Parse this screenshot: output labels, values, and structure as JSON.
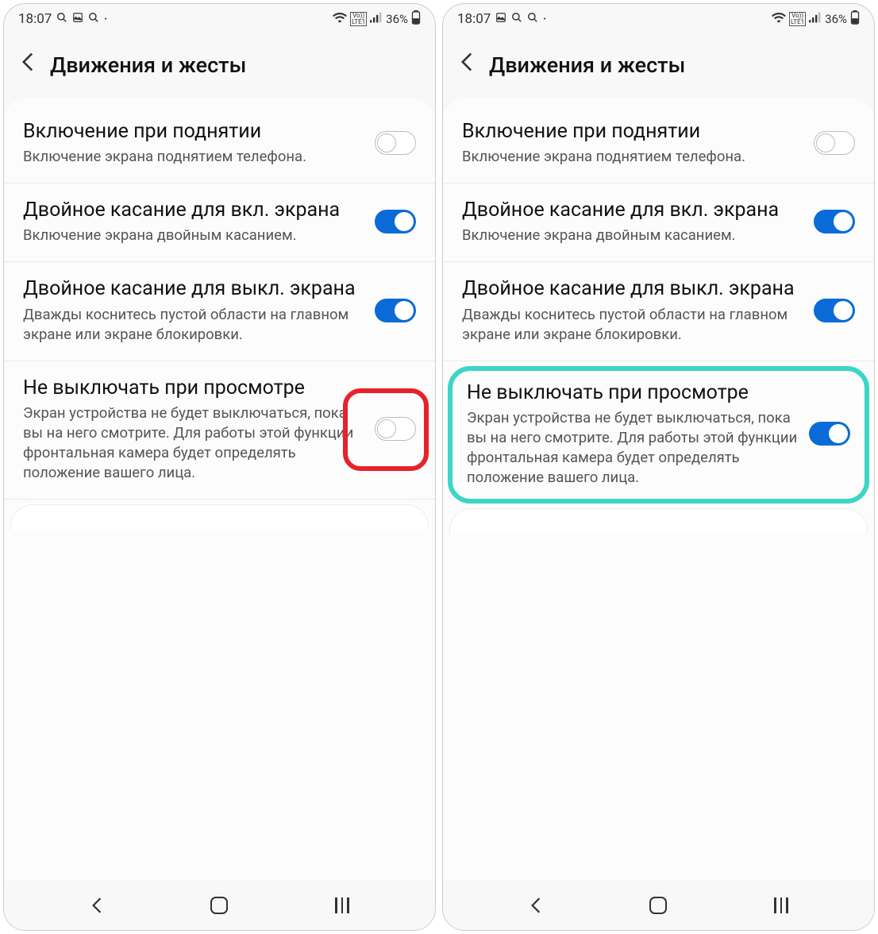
{
  "status": {
    "time": "18:07",
    "icons_left": [
      "search-icon",
      "gallery-icon",
      "search-icon",
      "dot-icon"
    ],
    "volte": "Vo))\nLTE1",
    "battery_pct": "36%"
  },
  "header": {
    "title": "Движения и жесты"
  },
  "items": {
    "lift_wake": {
      "title": "Включение при поднятии",
      "desc": "Включение экрана поднятием телефона."
    },
    "dtap_on": {
      "title": "Двойное касание для вкл. экрана",
      "desc": "Включение экрана двойным касанием."
    },
    "dtap_off": {
      "title": "Двойное касание для выкл. экрана",
      "desc": "Дважды коснитесь пустой области на главном экране или экране блокировки."
    },
    "stay_on": {
      "title": "Не выключать при просмотре",
      "desc": "Экран устройства не будет выключаться, пока вы на него смотрите. Для работы этой функции фронтальная камера будет определять положение вашего лица."
    }
  },
  "screens": {
    "left": {
      "status_icons_order": [
        "search",
        "gallery",
        "search",
        "dot"
      ],
      "toggles": {
        "lift_wake": false,
        "dtap_on": true,
        "dtap_off": true,
        "stay_on": false
      },
      "highlight": {
        "type": "red-circle",
        "target": "stay_on_toggle"
      }
    },
    "right": {
      "status_icons_order": [
        "gallery",
        "search",
        "search",
        "dot"
      ],
      "toggles": {
        "lift_wake": false,
        "dtap_on": true,
        "dtap_off": true,
        "stay_on": true
      },
      "highlight": {
        "type": "teal-box",
        "target": "stay_on_item"
      }
    }
  },
  "colors": {
    "toggle_on": "#0a6bd8",
    "highlight_red": "#e8222a",
    "highlight_teal": "#3bd6c6"
  }
}
